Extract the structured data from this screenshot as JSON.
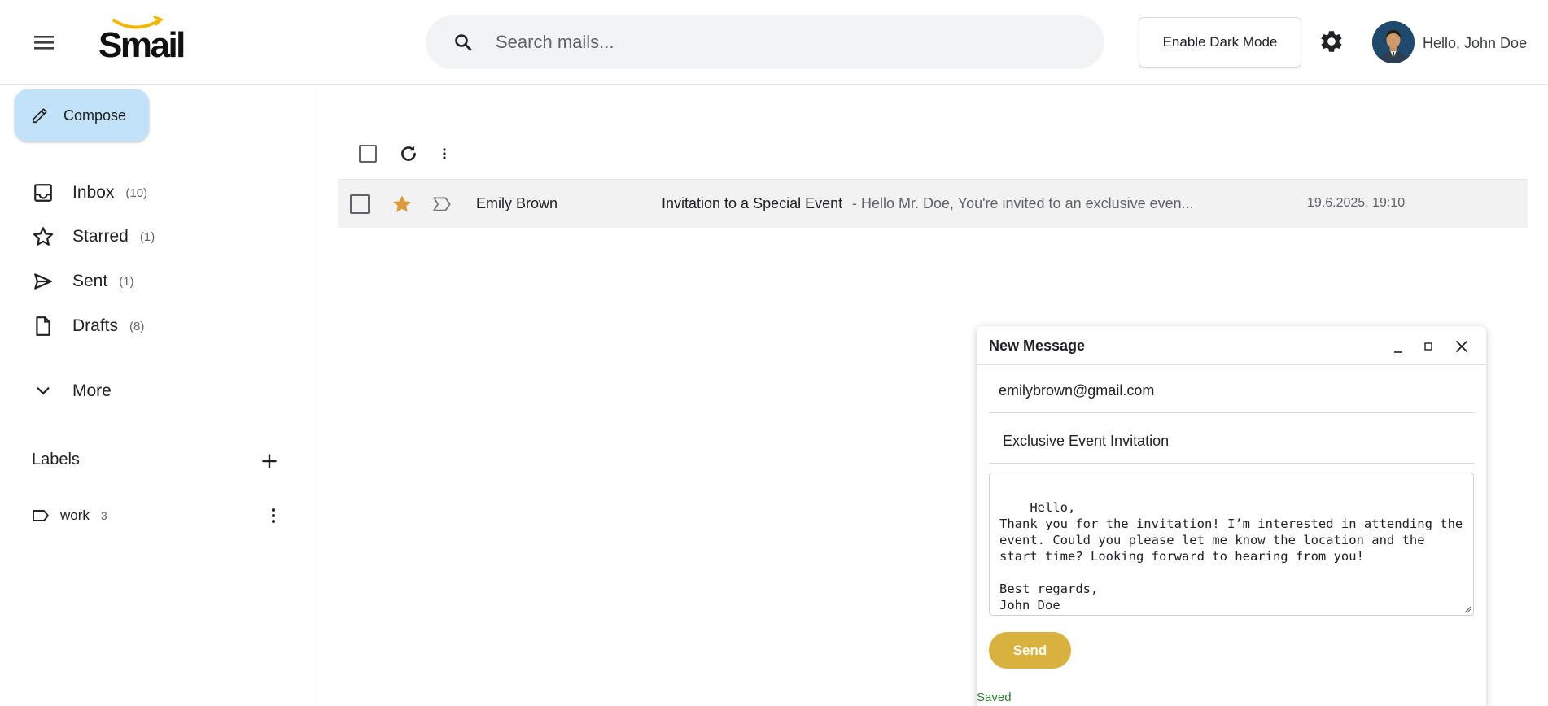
{
  "header": {
    "logo_text": "Smail",
    "search_placeholder": "Search mails...",
    "dark_mode_label": "Enable Dark Mode",
    "greeting": "Hello, John Doe"
  },
  "sidebar": {
    "compose_label": "Compose",
    "items": [
      {
        "label": "Inbox",
        "count": "(10)",
        "icon": "inbox-icon"
      },
      {
        "label": "Starred",
        "count": "(1)",
        "icon": "star-icon"
      },
      {
        "label": "Sent",
        "count": "(1)",
        "icon": "send-icon"
      },
      {
        "label": "Drafts",
        "count": "(8)",
        "icon": "draft-icon"
      }
    ],
    "more_label": "More",
    "labels_title": "Labels",
    "labels": [
      {
        "name": "work",
        "count": "3"
      }
    ]
  },
  "mail_list": {
    "rows": [
      {
        "sender": "Emily Brown",
        "subject": "Invitation to a Special Event",
        "snippet": "- Hello Mr. Doe, You're invited to an exclusive even...",
        "date": "19.6.2025, 19:10",
        "starred": true
      }
    ]
  },
  "compose_window": {
    "title": "New Message",
    "to": "emilybrown@gmail.com",
    "subject": "Exclusive Event Invitation",
    "body": "Hello,\nThank you for the invitation! I’m interested in attending the event. Could you please let me know the location and the start time? Looking forward to hearing from you!\n\nBest regards,\nJohn Doe",
    "send_label": "Send",
    "status": "Saved"
  },
  "colors": {
    "compose_bg": "#c2e2f9",
    "star": "#e09a3e",
    "send_button": "#d8b13f",
    "saved_text": "#2e7d32",
    "logo_smile": "#f4b400"
  }
}
